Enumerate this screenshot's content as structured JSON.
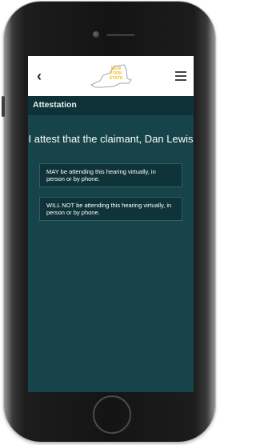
{
  "header": {
    "back_icon": "chevron-left-icon",
    "logo_lines": [
      "NEW",
      "YORK",
      "STATE"
    ],
    "menu_icon": "hamburger-icon"
  },
  "title": "Attestation",
  "statement": "I attest that the claimant, Dan Lewis",
  "options": [
    {
      "label": "MAY be attending this hearing virtually, in person or by phone."
    },
    {
      "label": "WILL NOT be attending this hearing virtually, in person or by phone."
    }
  ],
  "colors": {
    "screen_bg": "#17444a",
    "title_bar_bg": "#0f3238",
    "option_bg": "#0e3439",
    "option_border": "#2f5e64",
    "logo_gold": "#f2c234"
  }
}
